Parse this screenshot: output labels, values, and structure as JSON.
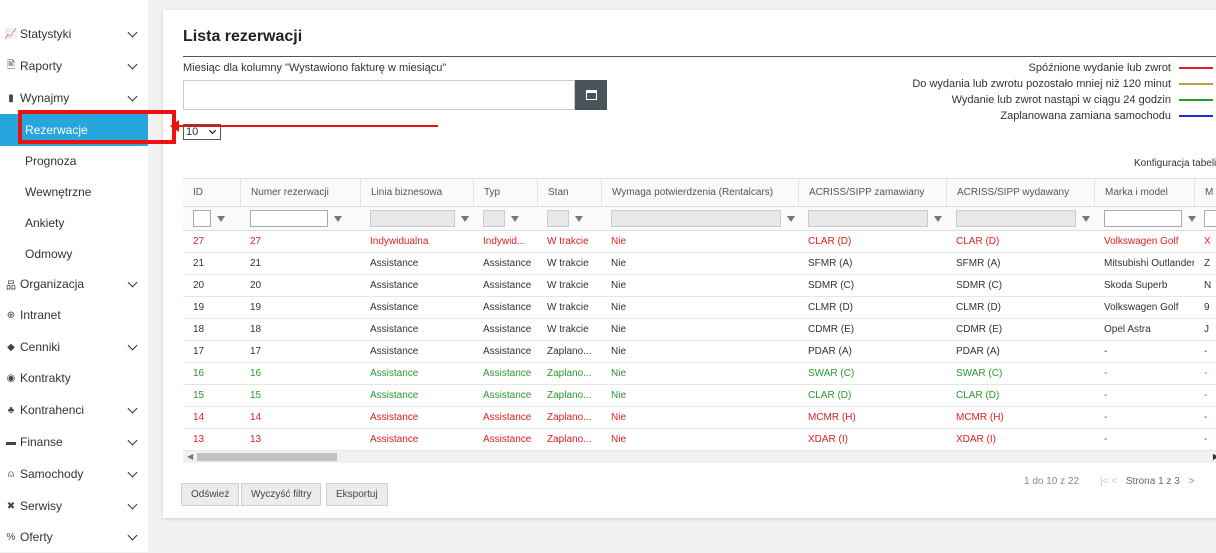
{
  "sidebar": {
    "items": [
      {
        "icon": "chart-icon",
        "glyph": "📈",
        "label": "Statystyki",
        "chevron": true
      },
      {
        "icon": "report-icon",
        "glyph": "🖹",
        "label": "Raporty",
        "chevron": true
      },
      {
        "icon": "document-icon",
        "glyph": "▮",
        "label": "Wynajmy",
        "chevron": true
      },
      {
        "label": "Rezerwacje",
        "sub": true,
        "active": true
      },
      {
        "label": "Prognoza",
        "sub": true
      },
      {
        "label": "Wewnętrzne",
        "sub": true
      },
      {
        "label": "Ankiety",
        "sub": true
      },
      {
        "label": "Odmowy",
        "sub": true
      },
      {
        "icon": "sitemap-icon",
        "glyph": "品",
        "label": "Organizacja",
        "chevron": true
      },
      {
        "icon": "globe-icon",
        "glyph": "⊕",
        "label": "Intranet",
        "chevron": false
      },
      {
        "icon": "tag-icon",
        "glyph": "◆",
        "label": "Cenniki",
        "chevron": true
      },
      {
        "icon": "handshake-icon",
        "glyph": "◉",
        "label": "Kontrakty",
        "chevron": false
      },
      {
        "icon": "users-icon",
        "glyph": "♣",
        "label": "Kontrahenci",
        "chevron": true
      },
      {
        "icon": "money-icon",
        "glyph": "▬",
        "label": "Finanse",
        "chevron": true
      },
      {
        "icon": "car-icon",
        "glyph": "⍝",
        "label": "Samochody",
        "chevron": true
      },
      {
        "icon": "wrench-icon",
        "glyph": "✖",
        "label": "Serwisy",
        "chevron": true
      },
      {
        "icon": "percent-icon",
        "glyph": "%",
        "label": "Oferty",
        "chevron": true
      }
    ]
  },
  "page": {
    "title": "Lista rezerwacji",
    "month_label": "Miesiąc dla kolumny \"Wystawiono fakturę w miesiącu\"",
    "month_value": "",
    "page_size": "10",
    "table_config": "Konfiguracja tabeli"
  },
  "legend": [
    {
      "label": "Spóźnione wydanie lub zwrot",
      "color": "#e02020"
    },
    {
      "label": "Do wydania lub zwrotu pozostało mniej niż 120 minut",
      "color": "#b8a24a"
    },
    {
      "label": "Wydanie lub zwrot nastąpi w ciągu 24 godzin",
      "color": "#2a9a2a"
    },
    {
      "label": "Zaplanowana zamiana samochodu",
      "color": "#1a2ee0"
    }
  ],
  "colors": {
    "red": "#e02020",
    "green": "#2a9a2a",
    "black": "#333333",
    "accent": "#26a6dd"
  },
  "table": {
    "columns": [
      "ID",
      "Numer rezerwacji",
      "Linia biznesowa",
      "Typ",
      "Stan",
      "Wymaga potwierdzenia (Rentalcars)",
      "ACRISS/SIPP zamawiany",
      "ACRISS/SIPP wydawany",
      "Marka i model",
      "M"
    ],
    "rows": [
      {
        "color": "red",
        "cells": [
          "27",
          "27",
          "Indywidualna",
          "Indywid...",
          "W trakcie",
          "Nie",
          "CLAR (D)",
          "CLAR (D)",
          "Volkswagen Golf",
          "X"
        ]
      },
      {
        "color": "black",
        "cells": [
          "21",
          "21",
          "Assistance",
          "Assistance",
          "W trakcie",
          "Nie",
          "SFMR (A)",
          "SFMR (A)",
          "Mitsubishi Outlander",
          "Z"
        ]
      },
      {
        "color": "black",
        "cells": [
          "20",
          "20",
          "Assistance",
          "Assistance",
          "W trakcie",
          "Nie",
          "SDMR (C)",
          "SDMR (C)",
          "Skoda Superb",
          "N"
        ]
      },
      {
        "color": "black",
        "cells": [
          "19",
          "19",
          "Assistance",
          "Assistance",
          "W trakcie",
          "Nie",
          "CLMR (D)",
          "CLMR (D)",
          "Volkswagen Golf",
          "9"
        ]
      },
      {
        "color": "black",
        "cells": [
          "18",
          "18",
          "Assistance",
          "Assistance",
          "W trakcie",
          "Nie",
          "CDMR (E)",
          "CDMR (E)",
          "Opel Astra",
          "J"
        ]
      },
      {
        "color": "black",
        "cells": [
          "17",
          "17",
          "Assistance",
          "Assistance",
          "Zaplano...",
          "Nie",
          "PDAR (A)",
          "PDAR (A)",
          "-",
          "-"
        ]
      },
      {
        "color": "green",
        "cells": [
          "16",
          "16",
          "Assistance",
          "Assistance",
          "Zaplano...",
          "Nie",
          "SWAR (C)",
          "SWAR (C)",
          "-",
          "-"
        ]
      },
      {
        "color": "green",
        "cells": [
          "15",
          "15",
          "Assistance",
          "Assistance",
          "Zaplano...",
          "Nie",
          "CLAR (D)",
          "CLAR (D)",
          "-",
          "-"
        ]
      },
      {
        "color": "red",
        "cells": [
          "14",
          "14",
          "Assistance",
          "Assistance",
          "Zaplano...",
          "Nie",
          "MCMR (H)",
          "MCMR (H)",
          "-",
          "-"
        ]
      },
      {
        "color": "red",
        "cells": [
          "13",
          "13",
          "Assistance",
          "Assistance",
          "Zaplano...",
          "Nie",
          "XDAR (I)",
          "XDAR (I)",
          "-",
          "-"
        ]
      }
    ]
  },
  "footer": {
    "refresh": "Odśwież",
    "clear_filters": "Wyczyść filtry",
    "export": "Eksportuj",
    "range_info": "1 do 10 z 22",
    "first": "|<",
    "prev": "<",
    "page_info": "Strona 1 z 3",
    "next": ">",
    "last": ">|"
  }
}
